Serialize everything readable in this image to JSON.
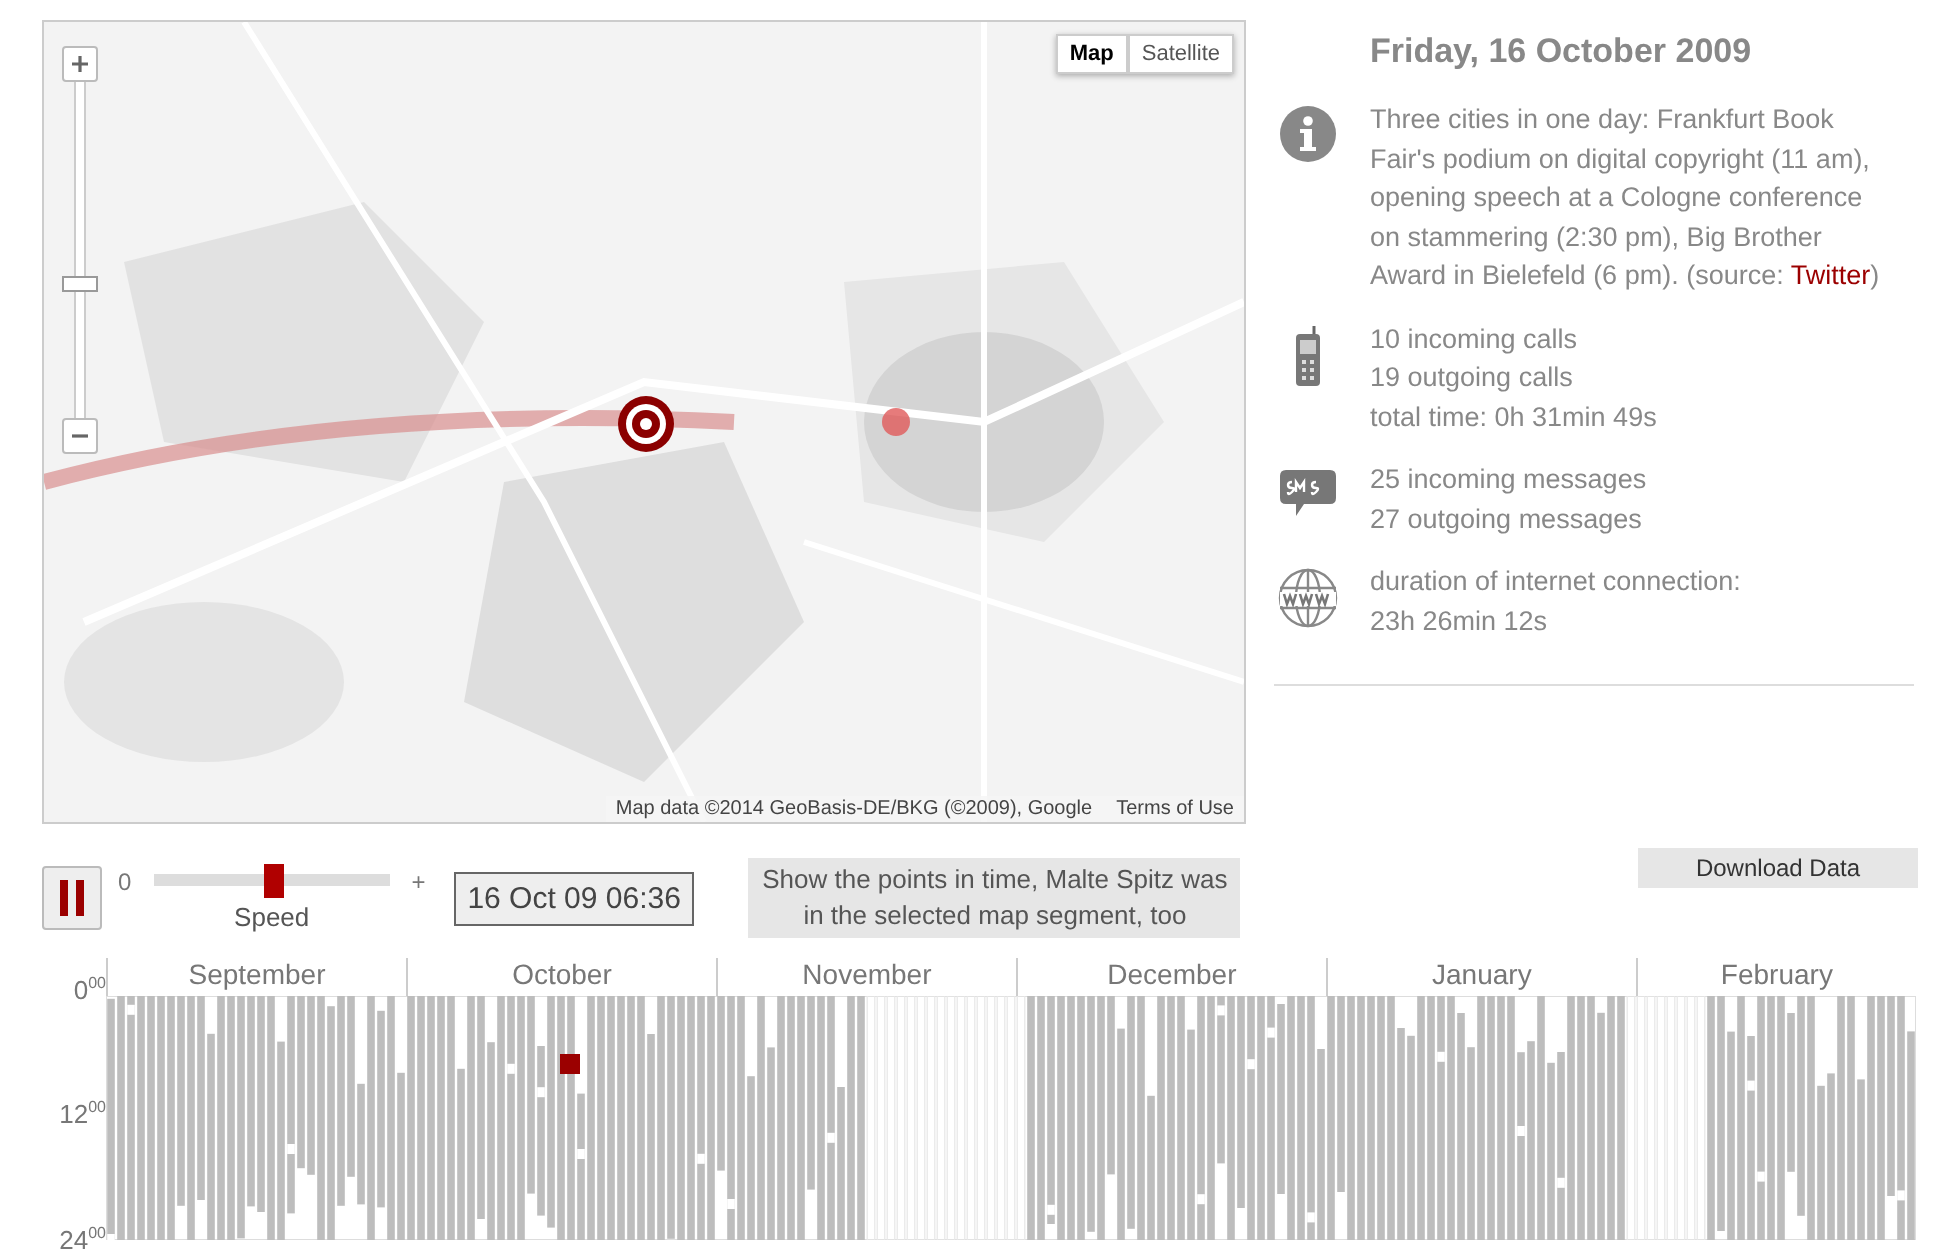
{
  "map": {
    "zoom": {
      "level": 0.4
    },
    "map_types": [
      {
        "label": "Map",
        "selected": true
      },
      {
        "label": "Satellite",
        "selected": false
      }
    ],
    "attribution": "Map data ©2014 GeoBasis-DE/BKG (©2009), Google",
    "terms": "Terms of Use"
  },
  "day": {
    "title": "Friday, 16 October 2009",
    "sections": [
      {
        "kind": "info",
        "lines": [
          "Three cities in one day: Frankfurt Book Fair's podium on digital copyright (11 am), opening speech at a Cologne conference on stammering (2:30 pm), Big Brother Award in Bielefeld (6 pm). (source: "
        ],
        "link": "Twitter",
        "after": ")"
      },
      {
        "kind": "calls",
        "lines": [
          "10 incoming calls",
          "19 outgoing calls",
          "total time: 0h 31min 49s"
        ]
      },
      {
        "kind": "sms",
        "lines": [
          "25 incoming messages",
          "27 outgoing messages"
        ]
      },
      {
        "kind": "web",
        "lines": [
          "duration of internet connection:",
          "23h 26min 12s"
        ]
      }
    ]
  },
  "controls": {
    "playing": true,
    "speed": {
      "min": "0",
      "max": "+",
      "label": "Speed",
      "level": 0.51
    },
    "time": "16 Oct 09 06:36",
    "hint": "Show the points in time, Malte Spitz was in the selected map segment, too",
    "download": "Download Data"
  },
  "timeline": {
    "hours": [
      "0$^{00}$",
      "12$^{00}$",
      "24$^{00}$"
    ],
    "months": [
      "September",
      "October",
      "November",
      "December",
      "January",
      "February"
    ]
  }
}
